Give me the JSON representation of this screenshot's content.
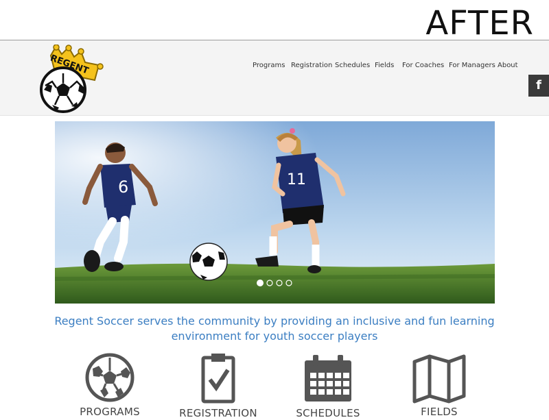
{
  "overlay_label": "AFTER",
  "brand": {
    "logo_text": "REGENT"
  },
  "nav": [
    "Programs",
    "Registration",
    "Schedules",
    "Fields",
    "For Coaches",
    "For Managers",
    "About"
  ],
  "social": {
    "facebook_label": "f"
  },
  "hero": {
    "slide_count": 4,
    "active_slide": 1,
    "jersey_boy": "6",
    "jersey_girl": "11"
  },
  "tagline": {
    "line1": "Regent Soccer serves the community by providing an inclusive and fun learning",
    "line2": "environment for youth soccer players"
  },
  "features": [
    "PROGRAMS",
    "REGISTRATION",
    "SCHEDULES",
    "FIELDS"
  ],
  "colors": {
    "accent": "#3b7ec2",
    "icon": "#555555",
    "header_bg": "#f4f4f4"
  }
}
